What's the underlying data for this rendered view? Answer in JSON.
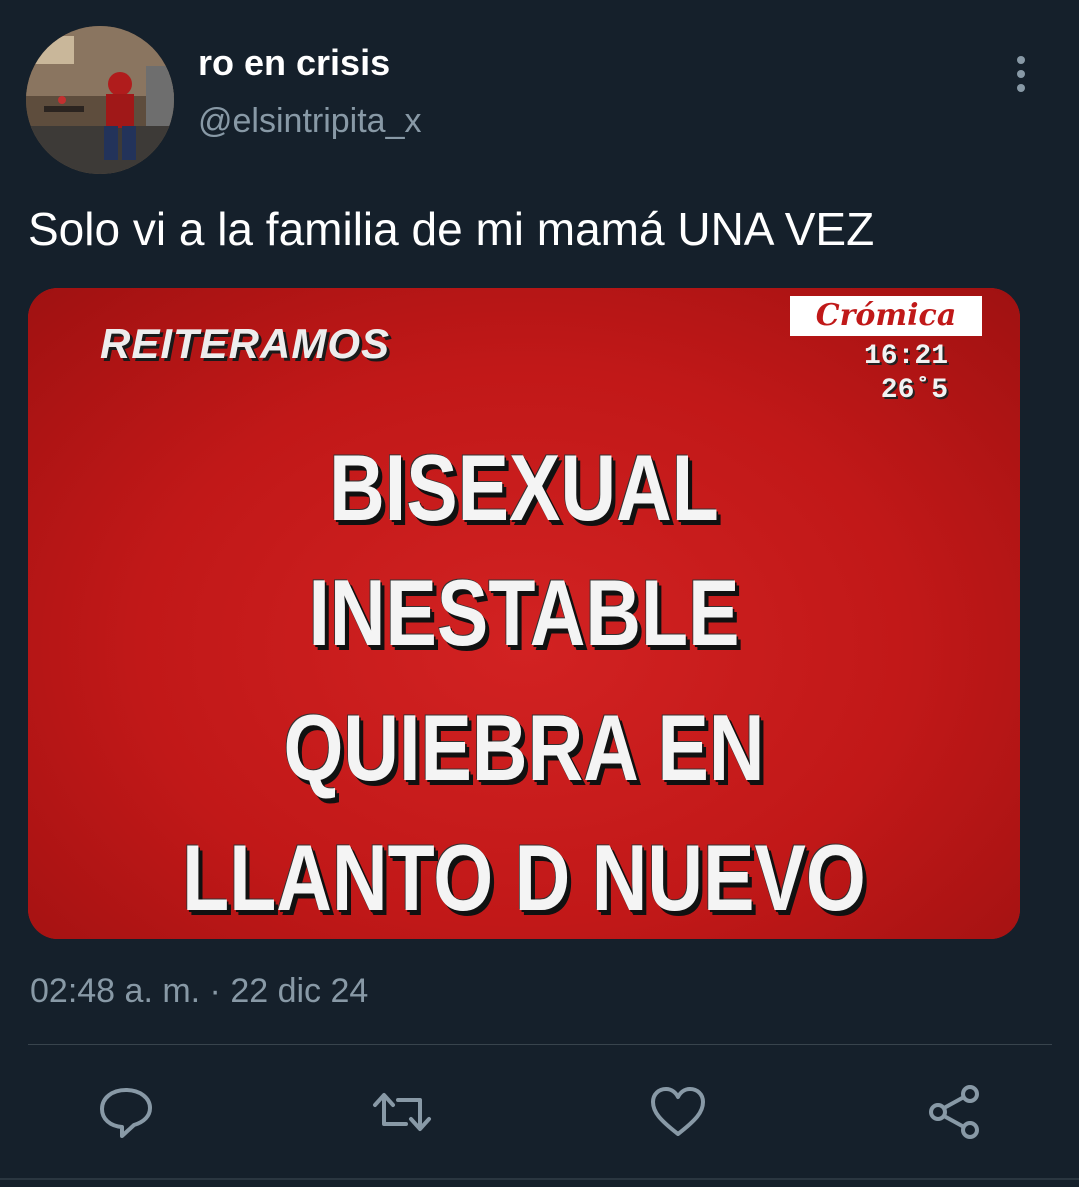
{
  "user": {
    "display_name": "ro en crisis",
    "handle": "@elsintripita_x"
  },
  "tweet": {
    "text": "Solo vi a la familia de mi mamá UNA VEZ",
    "timestamp": "02:48 a. m. · 22 dic 24"
  },
  "media": {
    "kicker": "REITERAMOS",
    "brand": "Crómica",
    "clock_time": "16:21",
    "clock_temp": "26˚5",
    "headline": [
      "BISEXUAL",
      "INESTABLE",
      "QUIEBRA EN",
      "LLANTO D NUEVO"
    ]
  },
  "actions": [
    "reply-icon",
    "retweet-icon",
    "like-icon",
    "share-icon"
  ],
  "colors": {
    "background": "#15202b",
    "secondary_text": "#8899a6",
    "media_red": "#c41d1d"
  }
}
